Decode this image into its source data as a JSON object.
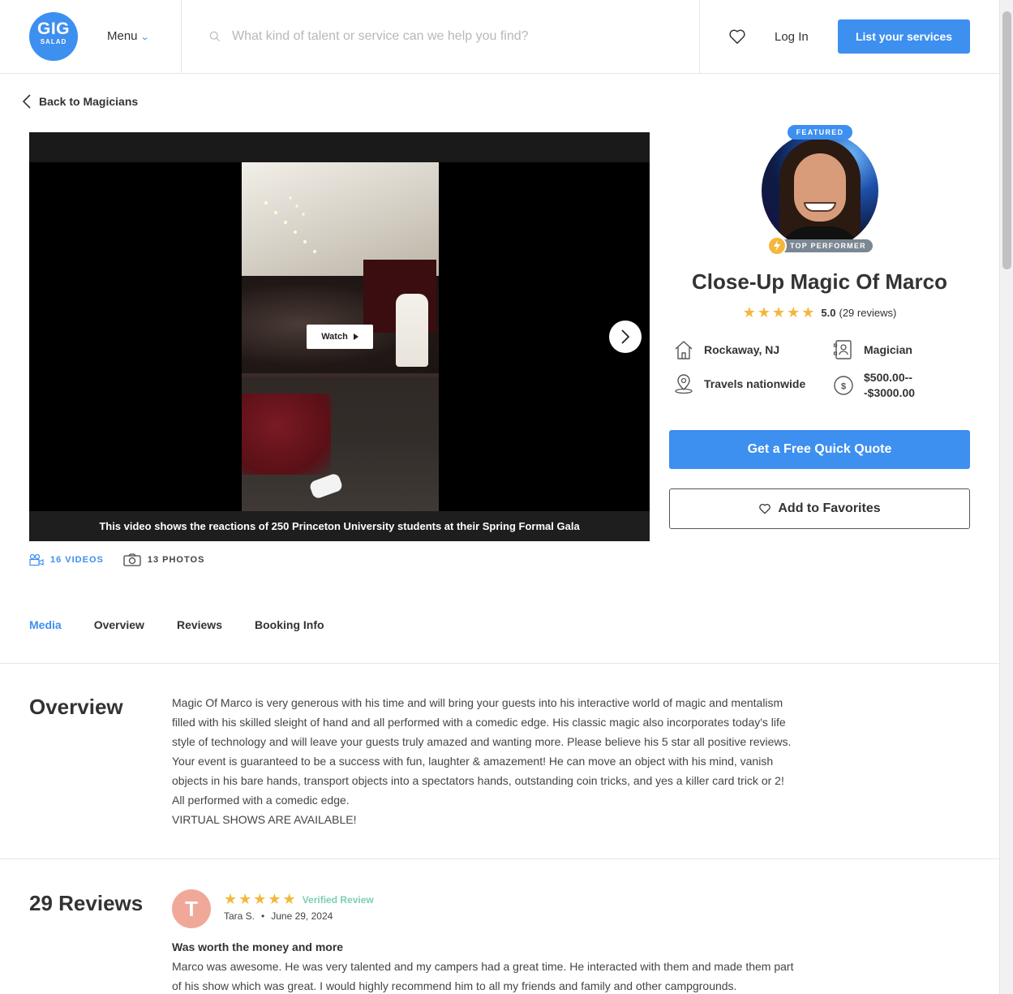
{
  "header": {
    "logo_line1": "GIG",
    "logo_line2": "SALAD",
    "menu_label": "Menu",
    "search_placeholder": "What kind of talent or service can we help you find?",
    "login_label": "Log In",
    "list_services_label": "List your services"
  },
  "back_link": "Back to Magicians",
  "video": {
    "watch_label": "Watch",
    "caption": "This video shows the reactions of 250 Princeton University students at their Spring Formal Gala"
  },
  "media_counts": {
    "videos": "16 VIDEOS",
    "photos": "13 PHOTOS"
  },
  "profile": {
    "featured_badge": "FEATURED",
    "top_performer_badge": "TOP PERFORMER",
    "name": "Close-Up Magic Of Marco",
    "stars": "★★★★★",
    "rating": "5.0",
    "reviews_count": "(29 reviews)",
    "location": "Rockaway, NJ",
    "category": "Magician",
    "travel": "Travels nationwide",
    "price_line1": "$500.00--",
    "price_line2": "-$3000.00",
    "quote_button": "Get a Free Quick Quote",
    "favorites_button": "Add to Favorites"
  },
  "tabs": [
    {
      "label": "Media",
      "active": true
    },
    {
      "label": "Overview",
      "active": false
    },
    {
      "label": "Reviews",
      "active": false
    },
    {
      "label": "Booking Info",
      "active": false
    }
  ],
  "overview": {
    "title": "Overview",
    "text": "Magic Of Marco is very generous with his time and will bring your guests into his interactive world of magic and mentalism filled with his skilled sleight of hand and all performed with a comedic edge. His classic magic also incorporates today's life style of technology and will leave your guests truly amazed and wanting more. Please believe his 5 star all positive reviews. Your event is guaranteed to be a success with fun, laughter & amazement! He can move an object with his mind, vanish objects in his bare hands, transport objects into a spectators hands, outstanding coin tricks, and yes a killer card trick or 2! All performed with a comedic edge.",
    "text2": "VIRTUAL SHOWS ARE AVAILABLE!"
  },
  "reviews": {
    "title": "29 Reviews",
    "items": [
      {
        "initial": "T",
        "stars": "★★★★★",
        "verified": "Verified Review",
        "author": "Tara S.",
        "date": "June 29, 2024",
        "subject": "Was worth the money and more",
        "body": "Marco was awesome. He was very talented and my campers had a great time. He interacted with them and made them part of his show which was great. I would highly recommend him to all my friends and family and other campgrounds."
      }
    ]
  },
  "colors": {
    "brand_blue": "#3d8ff0",
    "star_gold": "#f4b73b",
    "verified_green": "#7ccfb0"
  }
}
